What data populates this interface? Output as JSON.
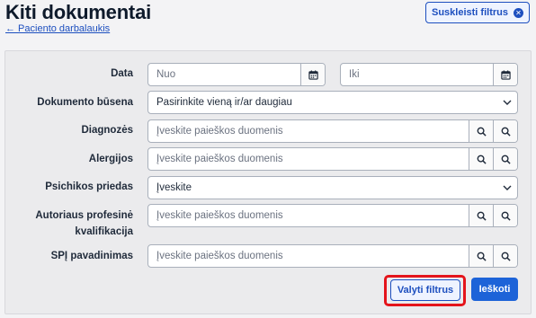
{
  "header": {
    "title": "Kiti dokumentai",
    "back_link": "← Paciento darbalaukis",
    "collapse_button": "Suskleisti filtrus"
  },
  "filters": {
    "date": {
      "label": "Data",
      "from_placeholder": "Nuo",
      "to_placeholder": "Iki"
    },
    "status": {
      "label": "Dokumento būsena",
      "value": "Pasirinkite vieną ir/ar daugiau"
    },
    "diagnoses": {
      "label": "Diagnozės",
      "placeholder": "Įveskite paieškos duomenis"
    },
    "allergies": {
      "label": "Alergijos",
      "placeholder": "Įveskite paieškos duomenis"
    },
    "mental_appendix": {
      "label": "Psichikos priedas",
      "value": "Įveskite"
    },
    "author_qualification": {
      "label_line1": "Autoriaus profesinė",
      "label_line2": "kvalifikacija",
      "placeholder": "Įveskite paieškos duomenis"
    },
    "institution": {
      "label": "SPĮ pavadinimas",
      "placeholder": "Įveskite paieškos duomenis"
    }
  },
  "actions": {
    "clear_label": "Valyti filtrus",
    "search_label": "Ieškoti"
  },
  "colors": {
    "accent": "#1d4fbf",
    "primary": "#1d63d8",
    "highlight": "#e4141b"
  }
}
